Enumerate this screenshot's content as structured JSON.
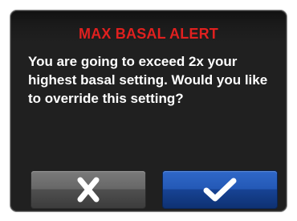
{
  "alert": {
    "title": "MAX BASAL ALERT",
    "message": "You are going to exceed 2x your highest basal setting. Would you like to override this setting?"
  },
  "buttons": {
    "cancel_icon": "x-icon",
    "confirm_icon": "checkmark-icon"
  },
  "colors": {
    "title": "#e0201f",
    "message": "#ffffff",
    "screen_background": "#202020",
    "cancel_button": "#5a5a5a",
    "confirm_button": "#1f4fa8"
  }
}
